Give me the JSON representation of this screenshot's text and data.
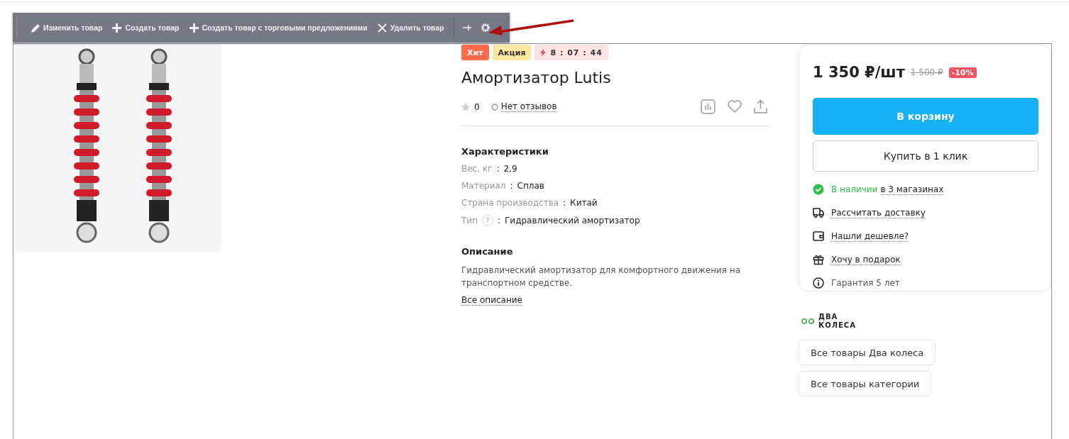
{
  "admin_toolbar": {
    "items": [
      {
        "kind": "edit",
        "label": "Изменить товар"
      },
      {
        "kind": "add",
        "label": "Создать товар"
      },
      {
        "kind": "add",
        "label": "Создать товар с торговыми предложениями"
      },
      {
        "kind": "delete",
        "label": "Удалить товар"
      }
    ]
  },
  "badges": [
    {
      "kind": "hit",
      "label": "Хит"
    },
    {
      "kind": "promo",
      "label": "Акция"
    },
    {
      "kind": "timer",
      "label": "8 : 07 : 44"
    }
  ],
  "title": "Амортизатор Lutis",
  "rating": {
    "count": "0"
  },
  "reviews_link": "Нет отзывов",
  "specs": {
    "heading": "Характеристики",
    "rows": [
      {
        "label": "Вес, кг",
        "separator": ":",
        "value": "2,9"
      },
      {
        "label": "Материал",
        "separator": ":",
        "value": "Сплав"
      },
      {
        "label": "Страна производства",
        "separator": ":",
        "value": "Китай"
      },
      {
        "label": "Тип",
        "help": "?",
        "separator": ":",
        "value": "Гидравлический амортизатор"
      }
    ]
  },
  "description": {
    "heading": "Описание",
    "text": "Гидравлический амортизатор для комфортного движения на транспортном средстве.",
    "link": "Все описание"
  },
  "buy_card": {
    "price": "1 350 ₽/шт",
    "old_price": "1 500 ₽",
    "discount": "-10%",
    "cart_button": "В корзину",
    "one_click_button": "Купить в 1 клик",
    "info": [
      {
        "kind": "stock",
        "status": "В наличии",
        "label": "в 3 магазинах"
      },
      {
        "kind": "delivery",
        "label": "Рассчитать доставку"
      },
      {
        "kind": "cheaper",
        "label": "Нашли дешевле?"
      },
      {
        "kind": "gift",
        "label": "Хочу в подарок"
      },
      {
        "kind": "warranty",
        "label": "Гарантия 5 лет"
      }
    ]
  },
  "brand": {
    "logo_lines": [
      "ДВА",
      "КОЛЕСА"
    ],
    "buttons": [
      "Все товары Два колеса",
      "Все товары категории"
    ]
  }
}
